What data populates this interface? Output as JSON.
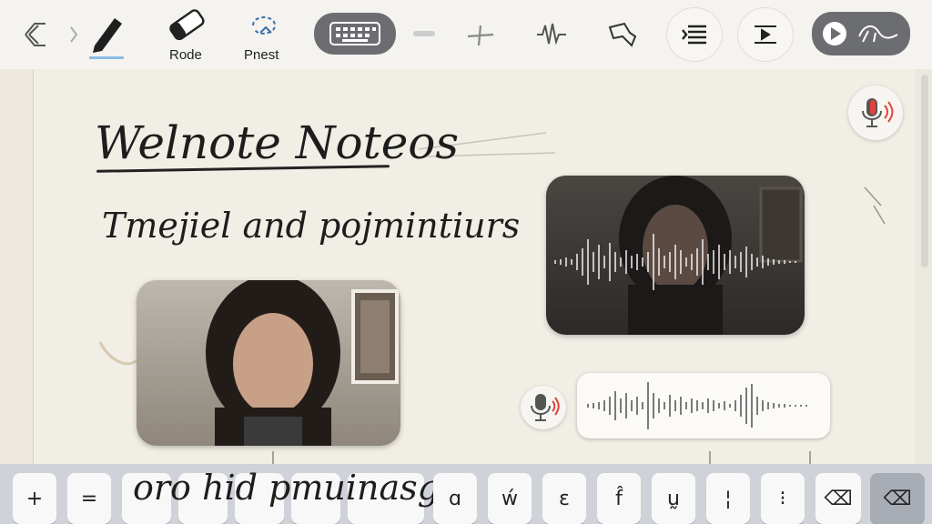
{
  "toolbar": {
    "tools": [
      {
        "name": "collapse",
        "label": ""
      },
      {
        "name": "pen",
        "label": ""
      },
      {
        "name": "eraser",
        "label": "Rode"
      },
      {
        "name": "lasso",
        "label": "Pnest"
      },
      {
        "name": "keyboard",
        "label": ""
      },
      {
        "name": "line",
        "label": ""
      },
      {
        "name": "waveform",
        "label": ""
      },
      {
        "name": "shape",
        "label": ""
      },
      {
        "name": "text-align",
        "label": ""
      },
      {
        "name": "insert",
        "label": ""
      },
      {
        "name": "playback",
        "label": ""
      }
    ]
  },
  "canvas": {
    "title": "Welnote Noteos",
    "subtitle": "Tmejiel and pojmintiurs",
    "handwriting_bottom": "oro hid pmuinasg t"
  },
  "keyboard": {
    "keys": [
      "+",
      "=",
      "",
      "",
      "",
      "",
      "",
      "ɑ",
      "ẃ",
      "ɛ",
      "f̂",
      "ṵ",
      "¦",
      "⁝",
      "⌫",
      "⌫"
    ]
  },
  "colors": {
    "toolbar_bg": "#f4f3f0",
    "paper_bg": "#f1eee6",
    "accent_blue": "#3b8fd9",
    "record_red": "#e0433a",
    "pill_dark": "#6c6d70"
  }
}
